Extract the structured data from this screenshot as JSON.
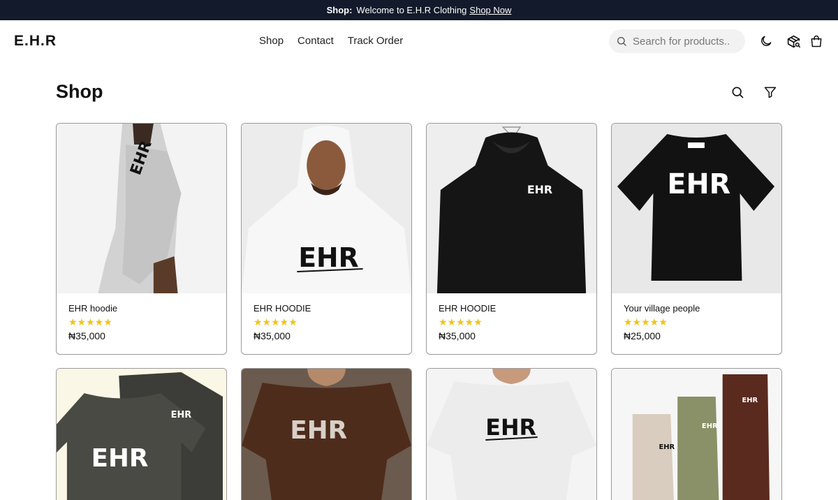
{
  "announcement": {
    "lead": "Shop:",
    "text": "Welcome to E.H.R Clothing",
    "link": "Shop Now"
  },
  "header": {
    "logo": "E.H.R",
    "nav": [
      "Shop",
      "Contact",
      "Track Order"
    ],
    "search_placeholder": "Search for products.."
  },
  "page": {
    "title": "Shop"
  },
  "products": [
    {
      "name": "EHR hoodie",
      "rating": 5,
      "stars": "★★★★★",
      "price": "₦35,000"
    },
    {
      "name": "EHR HOODIE",
      "rating": 5,
      "stars": "★★★★★",
      "price": "₦35,000"
    },
    {
      "name": "EHR HOODIE",
      "rating": 5,
      "stars": "★★★★★",
      "price": "₦35,000"
    },
    {
      "name": "Your village people",
      "rating": 5,
      "stars": "★★★★★",
      "price": "₦25,000"
    }
  ],
  "icons": {
    "search": "search-icon",
    "theme": "moon-icon",
    "track": "package-search-icon",
    "cart": "shopping-bag-icon",
    "filter": "filter-icon"
  },
  "colors": {
    "announcement_bg": "#121a2b",
    "stars": "#f3c316",
    "search_bg": "#f2f2f2",
    "card_border": "#9a9a9a"
  }
}
